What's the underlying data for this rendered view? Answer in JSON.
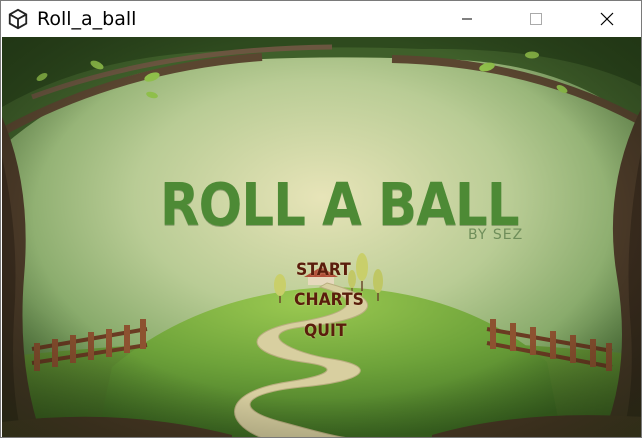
{
  "window": {
    "title": "Roll_a_ball",
    "app_icon": "unity-logo-icon",
    "controls": [
      "minimize-icon",
      "maximize-icon",
      "close-icon"
    ]
  },
  "game": {
    "title": "ROLL A BALL",
    "byline": "BY SEZ",
    "menu": {
      "start": "START",
      "charts": "CHARTS",
      "quit": "QUIT"
    }
  },
  "colors": {
    "title_green": "#4d8a35",
    "menu_brown": "#5a1d0c",
    "sky": "#a9c28c",
    "hill": "#6ea33a"
  }
}
